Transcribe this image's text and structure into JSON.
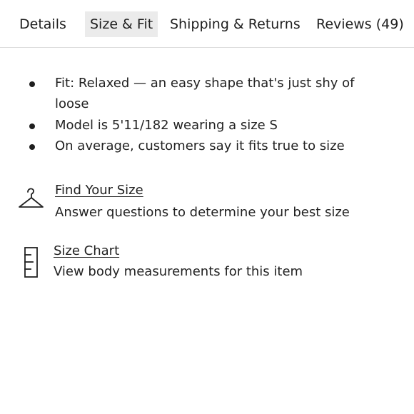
{
  "tabs": [
    {
      "label": "Details",
      "active": false
    },
    {
      "label": "Size & Fit",
      "active": true
    },
    {
      "label": "Shipping & Returns",
      "active": false
    },
    {
      "label": "Reviews (49)",
      "active": false
    }
  ],
  "bullets": [
    "Fit: Relaxed — an easy shape that's just shy of loose",
    "Model is 5'11/182 wearing a size S",
    "On average, customers say it fits true to size"
  ],
  "links": [
    {
      "title": "Find Your Size",
      "subtitle": "Answer questions to determine your best size",
      "icon": "hanger-icon"
    },
    {
      "title": "Size Chart",
      "subtitle": "View body measurements for this item",
      "icon": "ruler-icon"
    }
  ],
  "colors": {
    "text": "#222222",
    "active_tab_bg": "#ebebeb",
    "divider": "#dcdcdc"
  }
}
